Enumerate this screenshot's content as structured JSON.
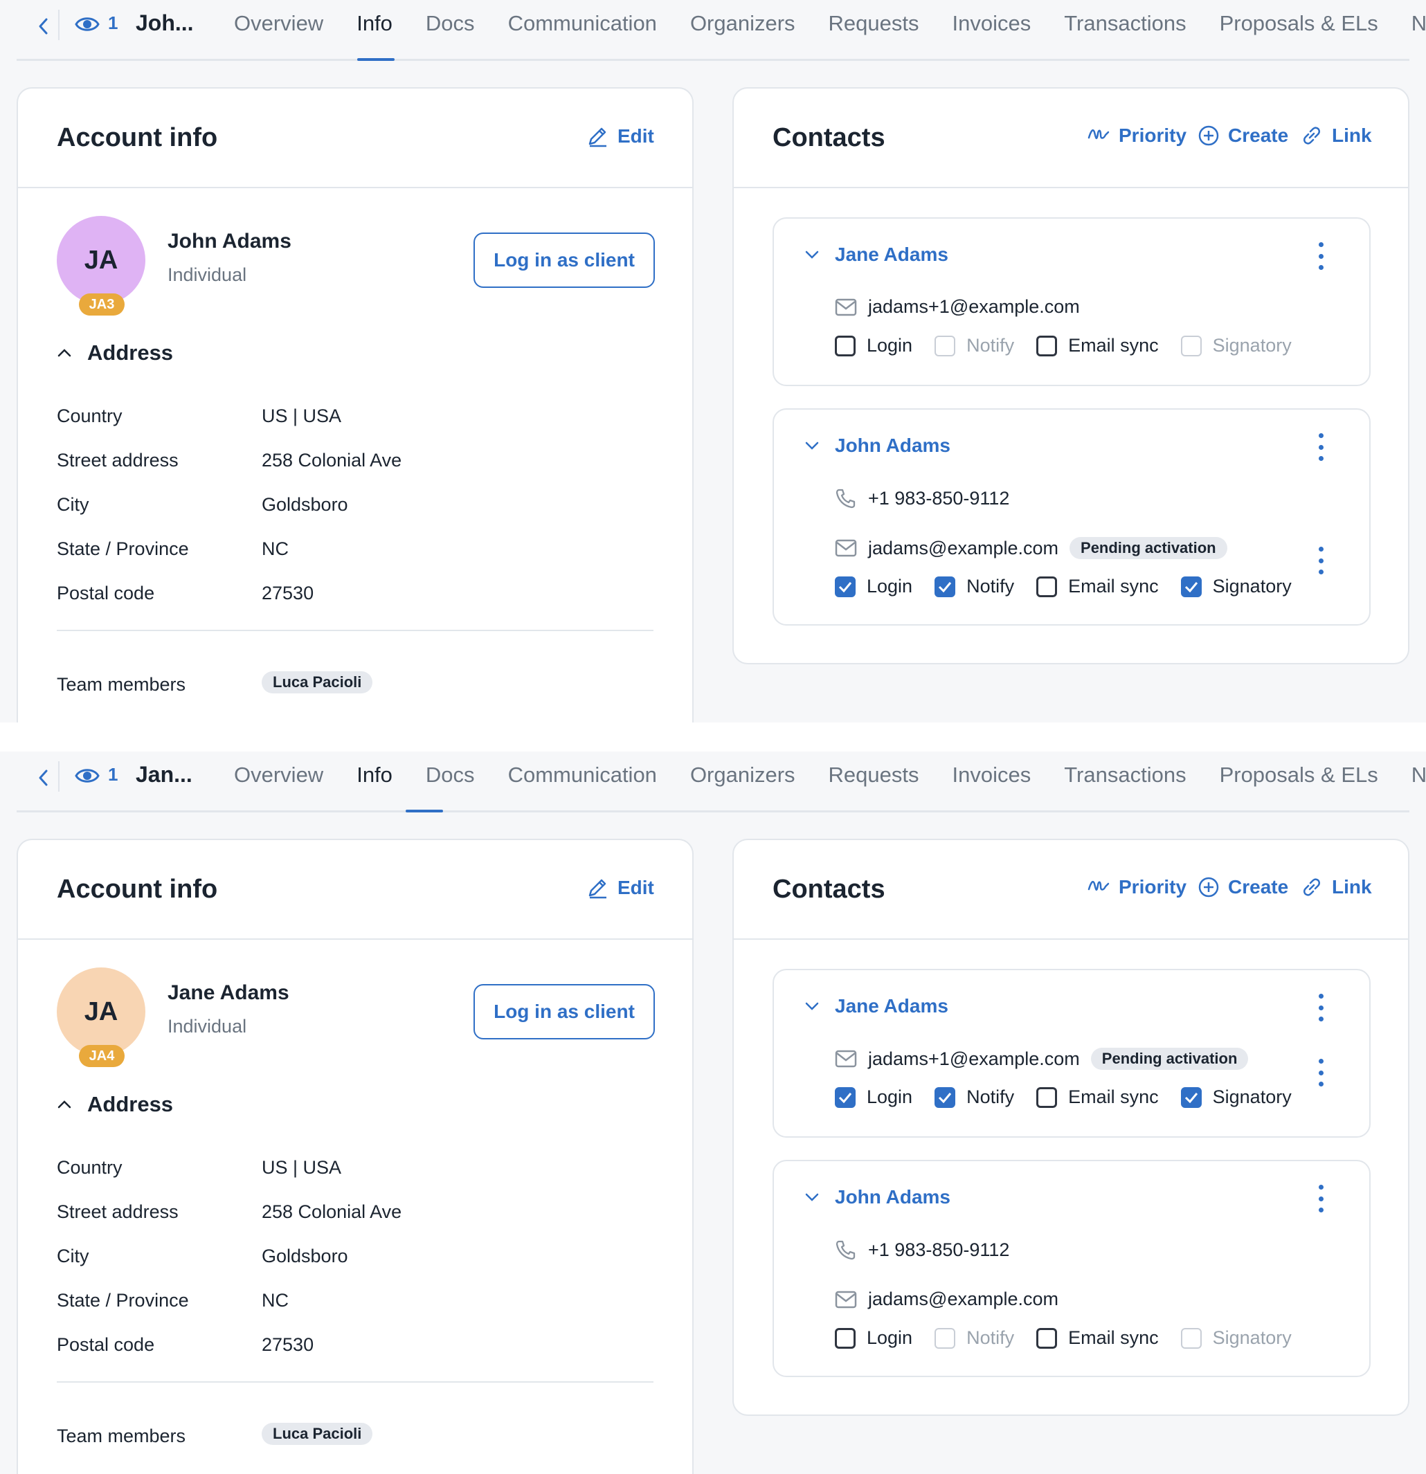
{
  "colors": {
    "accent": "#2f6fc6",
    "avatar_john": "#dfb3f4",
    "avatar_jane": "#f8d5b3",
    "tag": "#e9a93c"
  },
  "tabs": [
    "Overview",
    "Info",
    "Docs",
    "Communication",
    "Organizers",
    "Requests",
    "Invoices",
    "Transactions",
    "Proposals & ELs",
    "N"
  ],
  "views": [
    {
      "viewer_count": "1",
      "client_short": "Joh...",
      "account": {
        "title": "Account info",
        "edit_label": "Edit",
        "initials": "JA",
        "tag": "JA3",
        "name": "John Adams",
        "type": "Individual",
        "login_button": "Log in as client",
        "address_label": "Address",
        "address": [
          {
            "key": "Country",
            "value": "US | USA"
          },
          {
            "key": "Street address",
            "value": "258 Colonial Ave"
          },
          {
            "key": "City",
            "value": "Goldsboro"
          },
          {
            "key": "State / Province",
            "value": "NC"
          },
          {
            "key": "Postal code",
            "value": "27530"
          }
        ],
        "team_label": "Team members",
        "team_member": "Luca Pacioli"
      },
      "contacts": {
        "title": "Contacts",
        "priority_label": "Priority",
        "create_label": "Create",
        "link_label": "Link",
        "cards": [
          {
            "name": "Jane Adams",
            "email": "jadams+1@example.com",
            "login": "Login",
            "notify": "Notify",
            "email_sync": "Email sync",
            "signatory": "Signatory"
          },
          {
            "name": "John Adams",
            "phone": "+1 983-850-9112",
            "email": "jadams@example.com",
            "pending": "Pending activation",
            "login": "Login",
            "notify": "Notify",
            "email_sync": "Email sync",
            "signatory": "Signatory"
          }
        ]
      }
    },
    {
      "viewer_count": "1",
      "client_short": "Jan...",
      "account": {
        "title": "Account info",
        "edit_label": "Edit",
        "initials": "JA",
        "tag": "JA4",
        "name": "Jane Adams",
        "type": "Individual",
        "login_button": "Log in as client",
        "address_label": "Address",
        "address": [
          {
            "key": "Country",
            "value": "US | USA"
          },
          {
            "key": "Street address",
            "value": "258 Colonial Ave"
          },
          {
            "key": "City",
            "value": "Goldsboro"
          },
          {
            "key": "State / Province",
            "value": "NC"
          },
          {
            "key": "Postal code",
            "value": "27530"
          }
        ],
        "team_label": "Team members",
        "team_member": "Luca Pacioli"
      },
      "contacts": {
        "title": "Contacts",
        "priority_label": "Priority",
        "create_label": "Create",
        "link_label": "Link",
        "cards": [
          {
            "name": "Jane Adams",
            "email": "jadams+1@example.com",
            "pending": "Pending activation",
            "login": "Login",
            "notify": "Notify",
            "email_sync": "Email sync",
            "signatory": "Signatory"
          },
          {
            "name": "John Adams",
            "phone": "+1 983-850-9112",
            "email": "jadams@example.com",
            "login": "Login",
            "notify": "Notify",
            "email_sync": "Email sync",
            "signatory": "Signatory"
          }
        ]
      }
    }
  ]
}
